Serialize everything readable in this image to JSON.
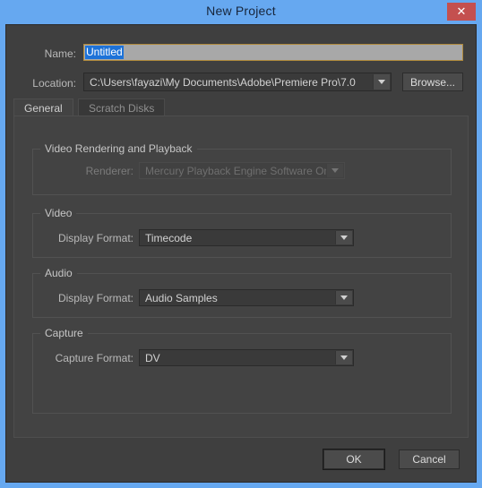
{
  "window": {
    "title": "New Project",
    "close_label": "✕",
    "accent_border": "#66a8f0",
    "close_button_color": "#c4504f"
  },
  "form": {
    "name": {
      "label": "Name:",
      "value": "Untitled",
      "placeholder": "Untitled",
      "selected_text": "Untitled"
    },
    "location": {
      "label": "Location:",
      "value": "C:\\Users\\fayazi\\My Documents\\Adobe\\Premiere Pro\\7.0",
      "browse_label": "Browse..."
    }
  },
  "tabs": [
    {
      "label": "General",
      "active": true
    },
    {
      "label": "Scratch Disks",
      "active": false
    }
  ],
  "general_tab": {
    "sections": [
      {
        "legend": "Video Rendering and Playback",
        "field_label": "Renderer:",
        "value": "Mercury Playback Engine Software Only",
        "disabled": true
      },
      {
        "legend": "Video",
        "field_label": "Display Format:",
        "value": "Timecode",
        "disabled": false
      },
      {
        "legend": "Audio",
        "field_label": "Display Format:",
        "value": "Audio Samples",
        "disabled": false
      },
      {
        "legend": "Capture",
        "field_label": "Capture Format:",
        "value": "DV",
        "disabled": false
      }
    ]
  },
  "footer": {
    "ok_label": "OK",
    "cancel_label": "Cancel"
  }
}
